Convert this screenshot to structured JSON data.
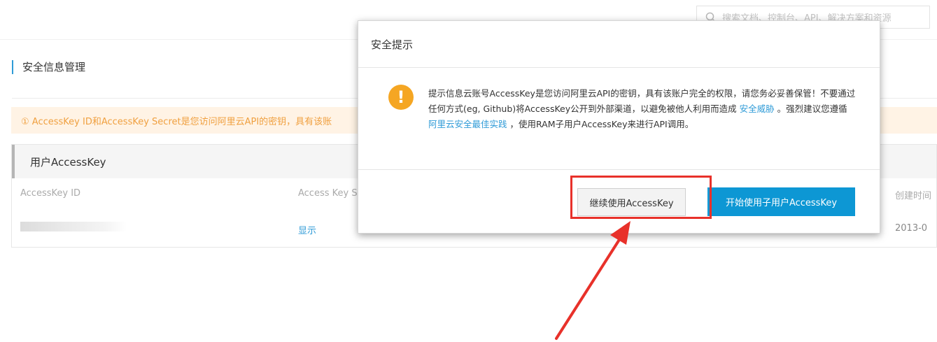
{
  "search": {
    "placeholder": "搜索文档、控制台、API、解决方案和资源",
    "icon": "search-icon"
  },
  "page": {
    "title": "安全信息管理"
  },
  "notice": {
    "text": "① AccessKey ID和AccessKey Secret是您访问阿里云API的密钥，具有该账"
  },
  "panel": {
    "title": "用户AccessKey",
    "columns": [
      "AccessKey ID",
      "Access Key S",
      "创建时间"
    ],
    "row": {
      "show_link": "显示",
      "created": "2013-0"
    }
  },
  "modal": {
    "title": "安全提示",
    "text_part1": "提示信息云账号AccessKey是您访问阿里云API的密钥，具有该账户完全的权限，请您务必妥善保管！不要通过任何方式(eg, Github)将AccessKey公开到外部渠道，以避免被他人利用而造成",
    "link1": "安全威胁",
    "text_part2": "。强烈建议您遵循",
    "link2": "阿里云安全最佳实践",
    "text_part3": "，使用RAM子用户AccessKey来进行API调用。",
    "continue_button": "继续使用AccessKey",
    "start_button": "开始使用子用户AccessKey"
  },
  "colors": {
    "accent": "#0d97d4",
    "warning": "#f5a623",
    "annotation": "#e8312a"
  }
}
